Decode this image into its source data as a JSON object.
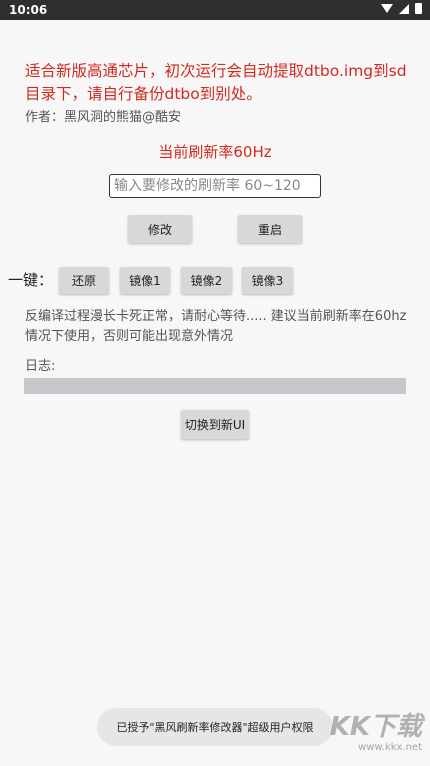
{
  "status_bar": {
    "time": "10:06"
  },
  "warning_text": "适合新版高通芯片，初次运行会自动提取dtbo.img到sd目录下，请自行备份dtbo到别处。",
  "author_text": "作者：黑风洞的熊猫@酷安",
  "current_rate_text": "当前刷新率60Hz",
  "rate_input": {
    "placeholder": "输入要修改的刷新率 60~120",
    "value": ""
  },
  "buttons": {
    "modify": "修改",
    "reboot": "重启"
  },
  "one_key": {
    "label": "一键：",
    "buttons": [
      "还原",
      "镜像1",
      "镜像2",
      "镜像3"
    ]
  },
  "note_text": "反编译过程漫长卡死正常，请耐心等待..... 建议当前刷新率在60hz情况下使用，否则可能出现意外情况",
  "log_label": "日志:",
  "switch_ui_button": "切换到新UI",
  "toast_text": "已授予\"黑风刷新率修改器\"超级用户权限",
  "watermark": {
    "logo": "KK下载",
    "url": "www.kkx.net"
  },
  "colors": {
    "warning_red": "#d22a1e",
    "status_bar": "#2f2f2f",
    "button_gray": "#d8d8d8"
  }
}
